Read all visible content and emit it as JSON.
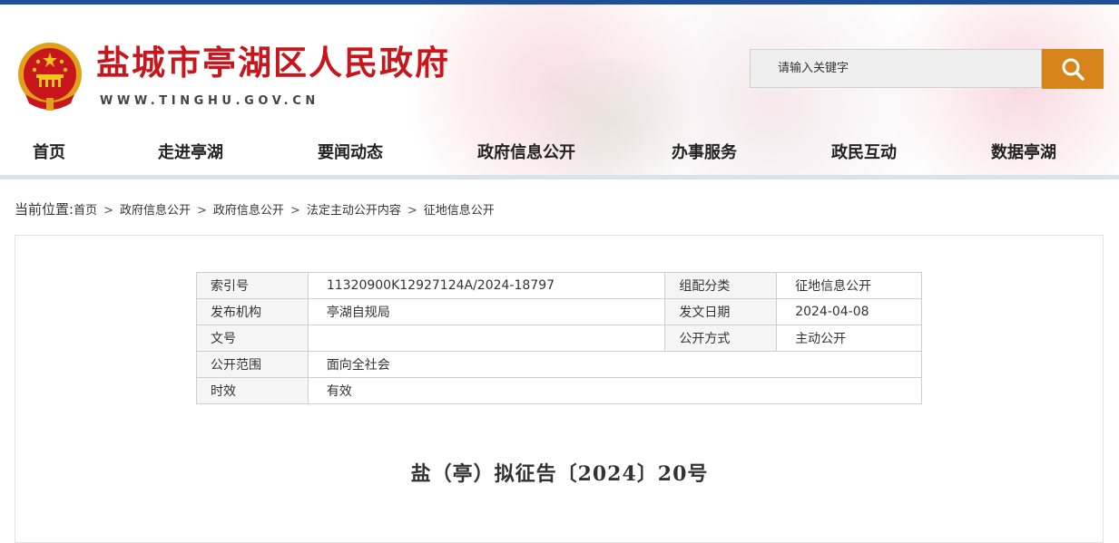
{
  "colors": {
    "accent_red": "#c8161d",
    "top_bar": "#1d4f96",
    "search_button": "#d7851a",
    "nav_underline": "#d8e3ee"
  },
  "header": {
    "site_title": "盐城市亭湖区人民政府",
    "site_url": "WWW.TINGHU.GOV.CN",
    "emblem_icon": "national-emblem-icon",
    "search": {
      "placeholder": "请输入关键字",
      "button_icon": "search-icon"
    }
  },
  "nav": {
    "items": [
      {
        "label": "首页"
      },
      {
        "label": "走进亭湖"
      },
      {
        "label": "要闻动态"
      },
      {
        "label": "政府信息公开"
      },
      {
        "label": "办事服务"
      },
      {
        "label": "政民互动"
      },
      {
        "label": "数据亭湖"
      }
    ]
  },
  "breadcrumb": {
    "label": "当前位置:",
    "items": [
      "首页",
      "政府信息公开",
      "政府信息公开",
      "法定主动公开内容",
      "征地信息公开"
    ],
    "separator": ">"
  },
  "info_table": {
    "index_no_label": "索引号",
    "index_no_value": "11320900K12927124A/2024-18797",
    "category_label": "组配分类",
    "category_value": "征地信息公开",
    "publisher_label": "发布机构",
    "publisher_value": "亭湖自规局",
    "date_label": "发文日期",
    "date_value": "2024-04-08",
    "doc_no_label": "文号",
    "doc_no_value": "",
    "method_label": "公开方式",
    "method_value": "主动公开",
    "scope_label": "公开范围",
    "scope_value": "面向全社会",
    "validity_label": "时效",
    "validity_value": "有效"
  },
  "document": {
    "title": "盐（亭）拟征告〔2024〕20号"
  }
}
